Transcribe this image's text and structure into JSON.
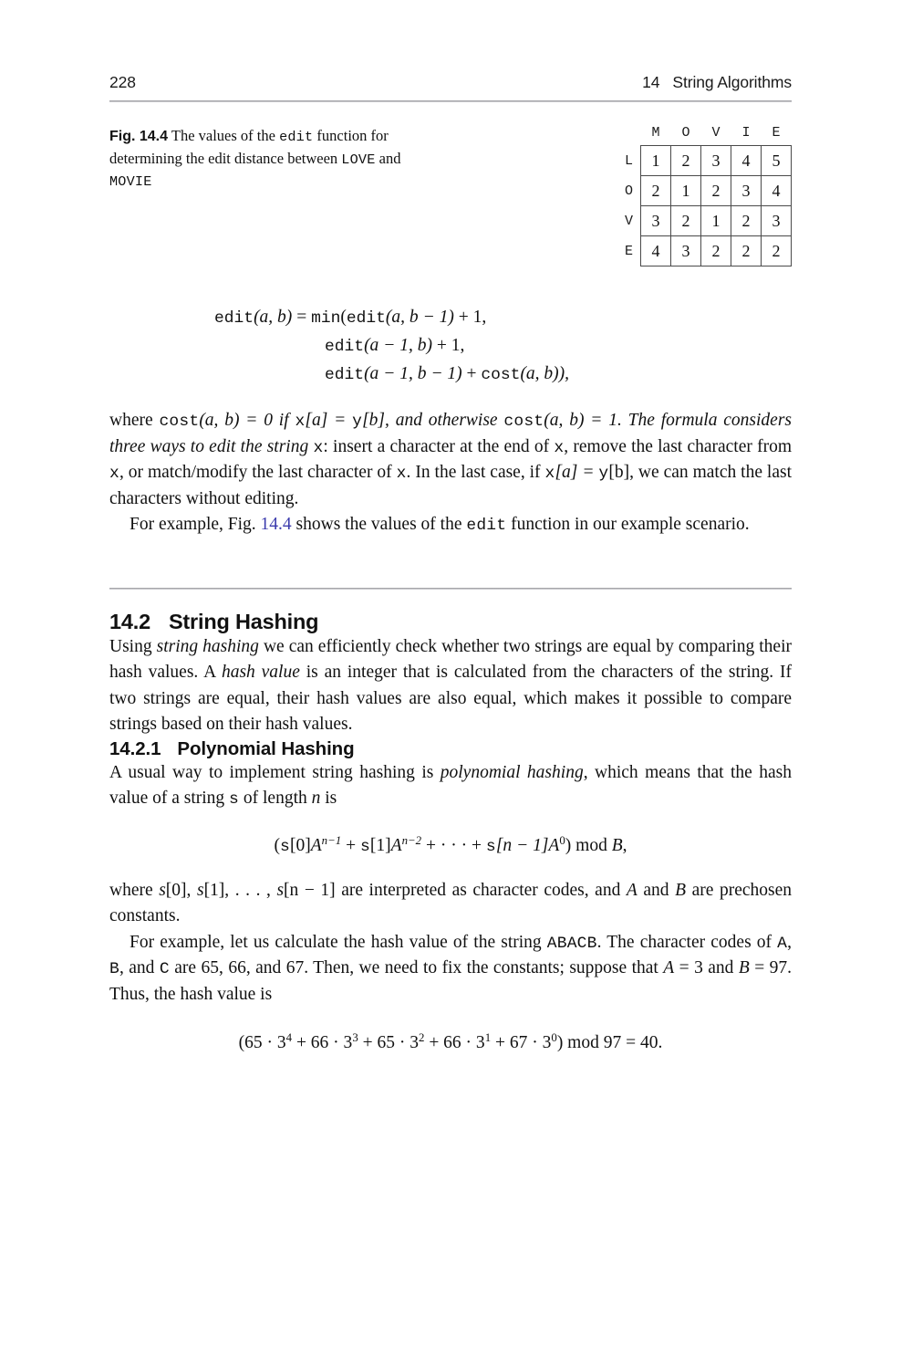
{
  "header": {
    "page_number": "228",
    "chapter_number": "14",
    "chapter_title": "String Algorithms"
  },
  "figure": {
    "label": "Fig. 14.4",
    "caption_part1": "The values of the",
    "caption_code1": "edit",
    "caption_part2": "function for determining the edit distance between",
    "caption_code2": "LOVE",
    "caption_part3": "and",
    "caption_code3": "MOVIE",
    "table": {
      "column_headers": [
        "M",
        "O",
        "V",
        "I",
        "E"
      ],
      "row_headers": [
        "L",
        "O",
        "V",
        "E"
      ],
      "rows": [
        [
          "1",
          "2",
          "3",
          "4",
          "5"
        ],
        [
          "2",
          "1",
          "2",
          "3",
          "4"
        ],
        [
          "3",
          "2",
          "1",
          "2",
          "3"
        ],
        [
          "4",
          "3",
          "2",
          "2",
          "2"
        ]
      ]
    }
  },
  "equation_edit": {
    "line1_lhs_fn": "edit",
    "line1_lhs_args": "(a, b)",
    "line1_eq": "=",
    "line1_min": "min",
    "line1_open": "(",
    "line1_fn": "edit",
    "line1_args": "(a, b − 1)",
    "line1_tail": "+ 1,",
    "line2_fn": "edit",
    "line2_args": "(a − 1, b)",
    "line2_tail": "+ 1,",
    "line3_fn": "edit",
    "line3_args": "(a − 1, b − 1)",
    "line3_plus": "+",
    "line3_cost": "cost",
    "line3_costargs": "(a, b)),"
  },
  "paragraphs": {
    "p_where_cost": {
      "s1": "where ",
      "c1": "cost",
      "s2": "(a, b) = 0 if ",
      "c2": "x",
      "s3": "[a] = ",
      "c3": "y",
      "s4": "[b], and otherwise ",
      "c4": "cost",
      "s5": "(a, b) = 1. The formula considers three ways to edit the string ",
      "c5": "x",
      "s6": ": insert a character at the end of ",
      "c6": "x",
      "s7": ", remove the last character from ",
      "c7": "x",
      "s8": ", or match/modify the last character of ",
      "c8": "x",
      "s9": ". In the last case, if ",
      "c9": "x",
      "s10": "[a] = ",
      "c10": "y",
      "s11": "[b], we can match the last characters without editing."
    },
    "p_for_example_fig": {
      "s1": "For example, Fig. ",
      "xref": "14.4",
      "s2": " shows the values of the ",
      "c1": "edit",
      "s3": " function in our example scenario."
    },
    "p_using_hashing": {
      "s1": "Using ",
      "i1": "string hashing",
      "s2": " we can efficiently check whether two strings are equal by comparing their hash values. A ",
      "i2": "hash value",
      "s3": " is an integer that is calculated from the characters of the string. If two strings are equal, their hash values are also equal, which makes it possible to compare strings based on their hash values."
    },
    "p_usual_way": {
      "s1": "A usual way to implement string hashing is ",
      "i1": "polynomial hashing",
      "s2": ", which means that the hash value of a string ",
      "c1": "s",
      "s3": " of length ",
      "i2": "n",
      "s4": " is"
    },
    "p_where_s": {
      "s1": "where ",
      "i1": "s",
      "s2": "[0], ",
      "i2": "s",
      "s3": "[1], . . . , ",
      "i3": "s",
      "s4": "[n − 1] are interpreted as character codes, and ",
      "i4": "A",
      "s5": " and ",
      "i5": "B",
      "s6": " are prechosen constants."
    },
    "p_for_example_hash": {
      "s1": "For example, let us calculate the hash value of the string ",
      "c1": "ABACB",
      "s2": ". The character codes of ",
      "c2": "A",
      "s3": ", ",
      "c3": "B",
      "s4": ", and ",
      "c4": "C",
      "s5": " are 65, 66, and 67. Then, we need to fix the constants; suppose that ",
      "i1": "A",
      "s6": " = 3 and ",
      "i2": "B",
      "s7": " = 97. Thus, the hash value is"
    }
  },
  "equation_poly": {
    "open": "(",
    "s0": "s",
    "idx0": "[0]",
    "A0": "A",
    "exp0": "n−1",
    "plus1": "+",
    "s1": "s",
    "idx1": "[1]",
    "A1": "A",
    "exp1": "n−2",
    "plus2": "+ · · · +",
    "s2": "s",
    "idx2": "[n − 1]",
    "A2": "A",
    "exp2": "0",
    "close": ")",
    "mod": "mod",
    "B": "B",
    "comma": ","
  },
  "equation_hash_value": {
    "open": "(65 · 3",
    "e1": "4",
    "t1": " + 66 · 3",
    "e2": "3",
    "t2": " + 65 · 3",
    "e3": "2",
    "t3": " + 66 · 3",
    "e4": "1",
    "t4": " + 67 · 3",
    "e5": "0",
    "close": ") mod 97 = 40."
  },
  "headings": {
    "section_number": "14.2",
    "section_title": "String Hashing",
    "subsection_number": "14.2.1",
    "subsection_title": "Polynomial Hashing"
  },
  "colors": {
    "text": "#111111",
    "crossref_link": "#3b3bad",
    "rule": "#9a9a9e",
    "grid_border": "#4a4a4a"
  }
}
